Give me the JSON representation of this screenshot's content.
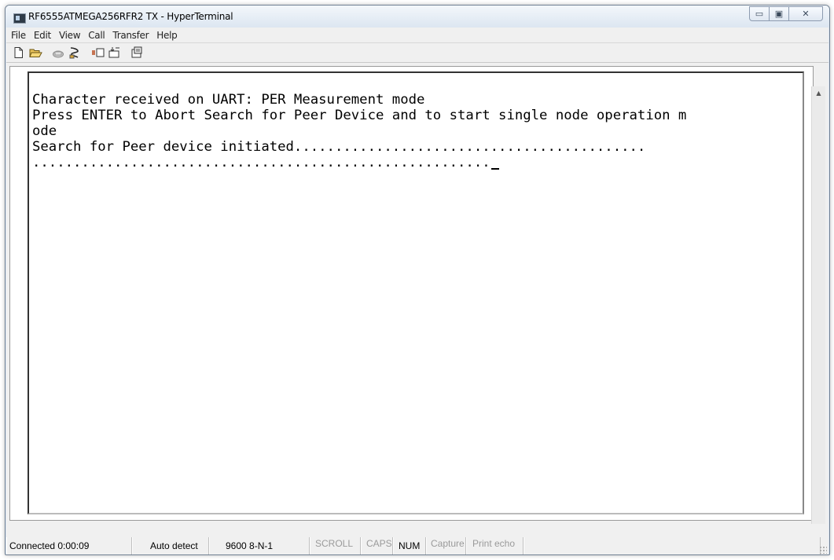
{
  "window": {
    "title": "RF6555ATMEGA256RFR2 TX - HyperTerminal",
    "icon": "hyperterminal-app-icon",
    "controls": {
      "minimize_icon": "minimize-icon",
      "maximize_icon": "maximize-icon",
      "close_icon": "close-icon"
    }
  },
  "menu": [
    "File",
    "Edit",
    "View",
    "Call",
    "Transfer",
    "Help"
  ],
  "toolbar": {
    "buttons": [
      "new-connection-icon",
      "open-icon",
      "disconnect-phone-icon",
      "dial-icon",
      "send-icon",
      "receive-icon",
      "properties-icon"
    ]
  },
  "terminal": {
    "lines": [
      "Character received on UART: PER Measurement mode",
      "Press ENTER to Abort Search for Peer Device and to start single node operation m",
      "ode",
      "Search for Peer device initiated...........................................",
      "........................................................"
    ]
  },
  "statusbar": {
    "connected": "Connected 0:00:09",
    "detect": "Auto detect",
    "settings": "9600 8-N-1",
    "scroll": "SCROLL",
    "caps": "CAPS",
    "num": "NUM",
    "capture": "Capture",
    "print_echo": "Print echo"
  }
}
